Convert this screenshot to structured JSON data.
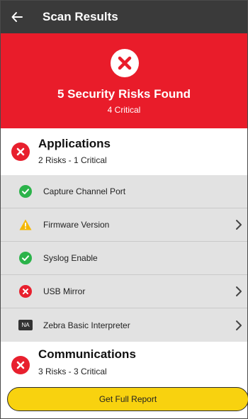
{
  "header": {
    "title": "Scan Results",
    "back_icon": "arrow-left-icon"
  },
  "banner": {
    "title": "5 Security Risks Found",
    "subtitle": "4 Critical",
    "icon": "error-x-icon",
    "color": "#e91c2a"
  },
  "applications": {
    "title": "Applications",
    "summary": "2 Risks - 1 Critical",
    "icon": "error-x-icon",
    "items": [
      {
        "label": "Capture Channel Port",
        "status": "pass",
        "icon": "check-circle-icon",
        "chevron": false
      },
      {
        "label": "Firmware Version",
        "status": "warning",
        "icon": "warning-triangle-icon",
        "chevron": true
      },
      {
        "label": "Syslog Enable",
        "status": "pass",
        "icon": "check-circle-icon",
        "chevron": false
      },
      {
        "label": "USB Mirror",
        "status": "critical",
        "icon": "error-x-icon",
        "chevron": true
      },
      {
        "label": "Zebra Basic Interpreter",
        "status": "not-applicable",
        "icon": "na-badge-icon",
        "badge_text": "NA",
        "chevron": true
      }
    ]
  },
  "communications": {
    "title": "Communications",
    "summary": "3 Risks - 3 Critical",
    "icon": "error-x-icon"
  },
  "footer": {
    "report_label": "Get Full Report",
    "button_color": "#f8d20f"
  },
  "colors": {
    "header_bg": "#3a3a3a",
    "critical": "#e8202e",
    "pass": "#2bb34a",
    "warning": "#f5b800",
    "list_bg": "#e2e2e2"
  }
}
